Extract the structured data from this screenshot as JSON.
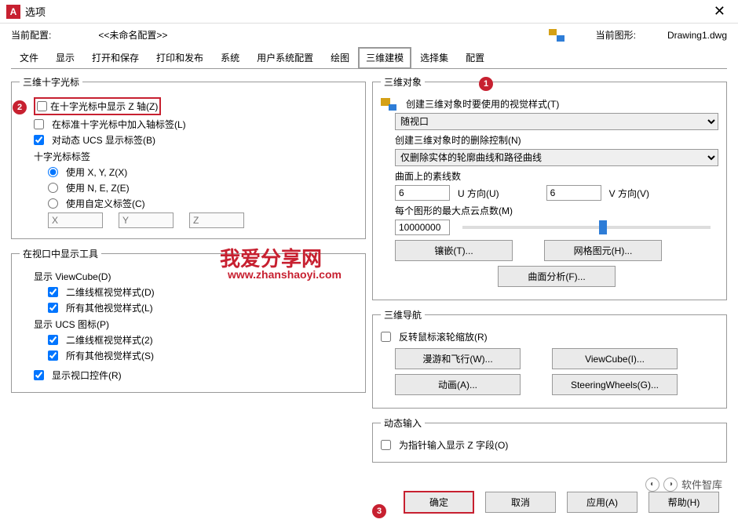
{
  "titlebar": {
    "app_icon": "A",
    "title": "选项"
  },
  "info": {
    "profile_label": "当前配置:",
    "profile_value": "<<未命名配置>>",
    "drawing_label": "当前图形:",
    "drawing_value": "Drawing1.dwg"
  },
  "tabs": [
    "文件",
    "显示",
    "打开和保存",
    "打印和发布",
    "系统",
    "用户系统配置",
    "绘图",
    "三维建模",
    "选择集",
    "配置"
  ],
  "active_tab": "三维建模",
  "badges": {
    "b1": "1",
    "b2": "2",
    "b3": "3"
  },
  "left": {
    "g1": {
      "legend": "三维十字光标",
      "cb1": "在十字光标中显示 Z 轴(Z)",
      "cb2": "在标准十字光标中加入轴标签(L)",
      "cb3": "对动态 UCS 显示标签(B)",
      "label": "十字光标标签",
      "r1": "使用 X, Y, Z(X)",
      "r2": "使用 N, E, Z(E)",
      "r3": "使用自定义标签(C)",
      "ph_x": "X",
      "ph_y": "Y",
      "ph_z": "Z"
    },
    "g2": {
      "legend": "在视口中显示工具",
      "sec1": "显示 ViewCube(D)",
      "cb1a": "二维线框视觉样式(D)",
      "cb1b": "所有其他视觉样式(L)",
      "sec2": "显示 UCS 图标(P)",
      "cb2a": "二维线框视觉样式(2)",
      "cb2b": "所有其他视觉样式(S)",
      "cb3": "显示视口控件(R)"
    }
  },
  "right": {
    "g1": {
      "legend": "三维对象",
      "vs_label": "创建三维对象时要使用的视觉样式(T)",
      "vs_value": "随视口",
      "del_label": "创建三维对象时的删除控制(N)",
      "del_value": "仅删除实体的轮廓曲线和路径曲线",
      "iso_label": "曲面上的素线数",
      "u_val": "6",
      "u_label": "U 方向(U)",
      "v_val": "6",
      "v_label": "V 方向(V)",
      "pc_label": "每个图形的最大点云点数(M)",
      "pc_val": "10000000",
      "btn_tess": "镶嵌(T)...",
      "btn_mesh": "网格图元(H)...",
      "btn_surf": "曲面分析(F)..."
    },
    "g2": {
      "legend": "三维导航",
      "cb1": "反转鼠标滚轮缩放(R)",
      "btn_walk": "漫游和飞行(W)...",
      "btn_vc": "ViewCube(I)...",
      "btn_anim": "动画(A)...",
      "btn_sw": "SteeringWheels(G)..."
    },
    "g3": {
      "legend": "动态输入",
      "cb1": "为指针输入显示 Z 字段(O)"
    }
  },
  "footer": {
    "ok": "确定",
    "cancel": "取消",
    "apply": "应用(A)",
    "help": "帮助(H)"
  },
  "watermark": {
    "line1": "我爱分享网",
    "line2": "www.zhanshaoyi.com"
  },
  "brand": "软件智库"
}
